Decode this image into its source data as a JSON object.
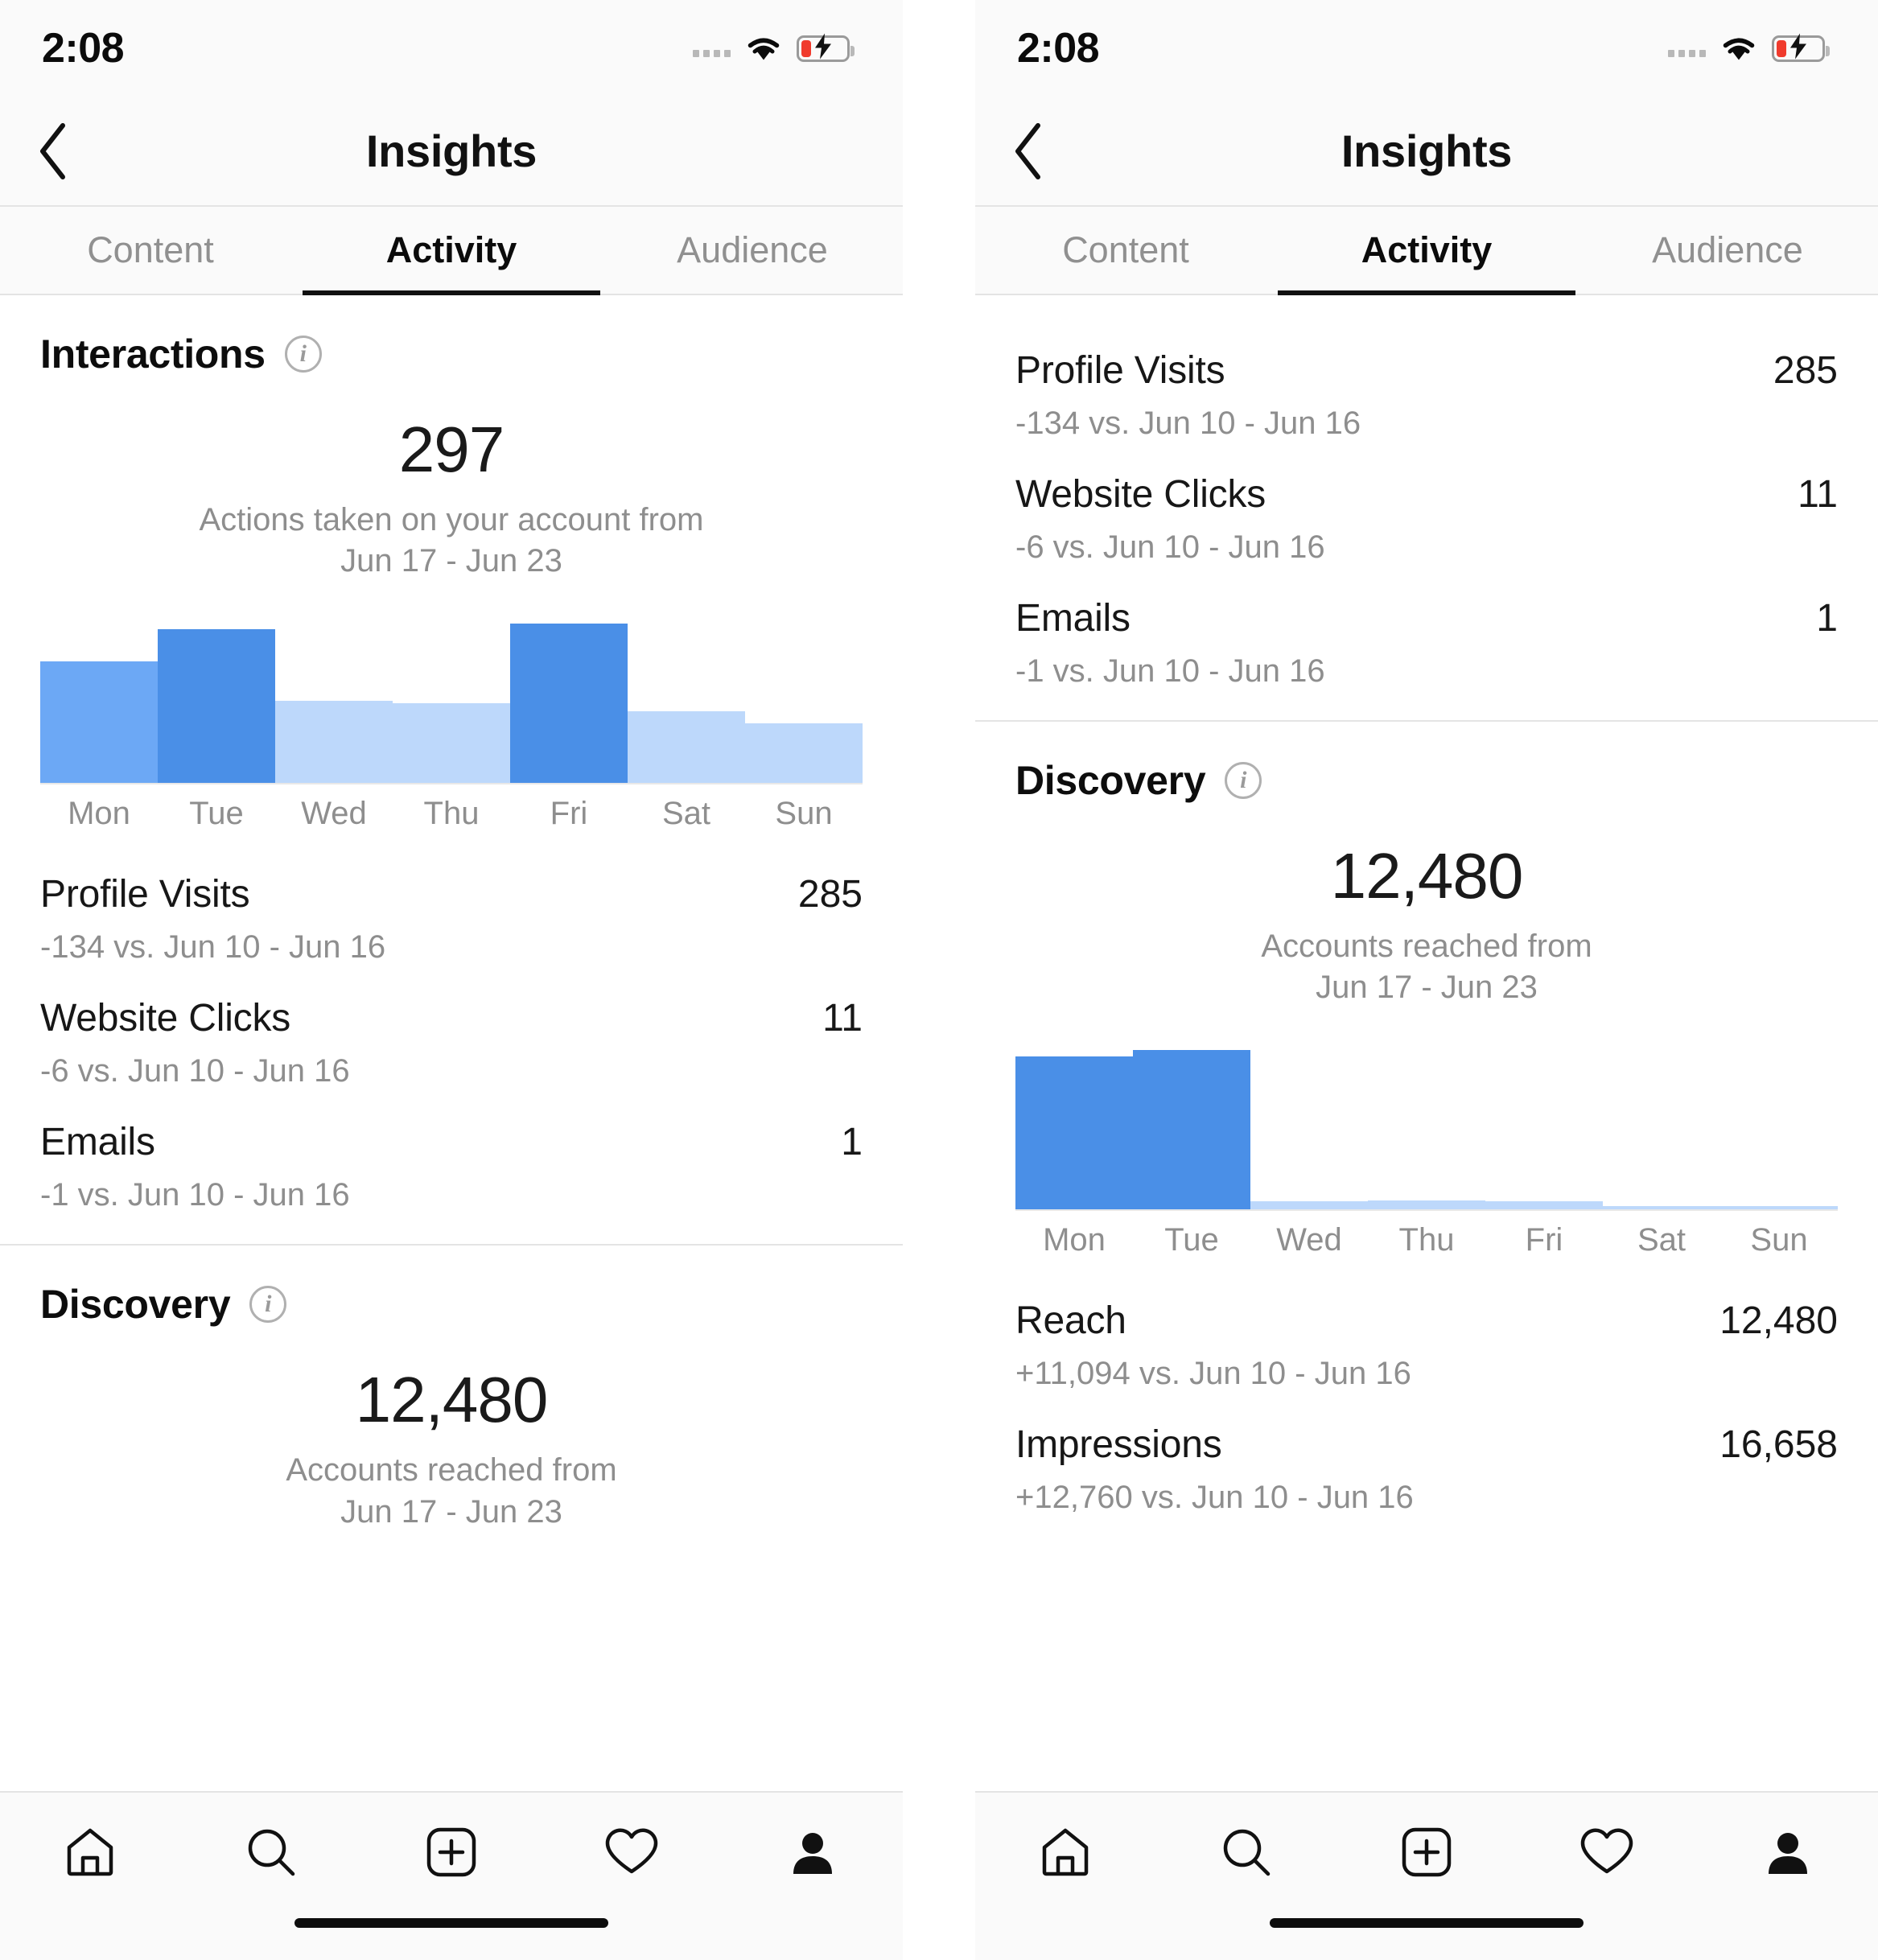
{
  "status_bar": {
    "time": "2:08",
    "signal_icon": "signal-dots-icon",
    "wifi_icon": "wifi-icon",
    "battery_icon": "battery-low-charging-icon"
  },
  "header": {
    "back_icon": "chevron-left-icon",
    "title": "Insights"
  },
  "tabs": [
    {
      "label": "Content",
      "active": false
    },
    {
      "label": "Activity",
      "active": true
    },
    {
      "label": "Audience",
      "active": false
    }
  ],
  "left_panel": {
    "interactions": {
      "title": "Interactions",
      "info_icon": "info-icon",
      "total": "297",
      "subtitle_line1": "Actions taken on your account from",
      "subtitle_line2": "Jun 17 - Jun 23"
    },
    "metrics": [
      {
        "name": "Profile Visits",
        "value": "285",
        "comparison": "-134 vs. Jun 10 - Jun 16"
      },
      {
        "name": "Website Clicks",
        "value": "11",
        "comparison": "-6 vs. Jun 10 - Jun 16"
      },
      {
        "name": "Emails",
        "value": "1",
        "comparison": "-1 vs. Jun 10 - Jun 16"
      }
    ],
    "discovery": {
      "title": "Discovery",
      "info_icon": "info-icon",
      "total": "12,480",
      "subtitle_line1": "Accounts reached from",
      "subtitle_line2": "Jun 17 - Jun 23"
    }
  },
  "right_panel": {
    "metrics": [
      {
        "name": "Profile Visits",
        "value": "285",
        "comparison": "-134 vs. Jun 10 - Jun 16"
      },
      {
        "name": "Website Clicks",
        "value": "11",
        "comparison": "-6 vs. Jun 10 - Jun 16"
      },
      {
        "name": "Emails",
        "value": "1",
        "comparison": "-1 vs. Jun 10 - Jun 16"
      }
    ],
    "discovery": {
      "title": "Discovery",
      "info_icon": "info-icon",
      "total": "12,480",
      "subtitle_line1": "Accounts reached from",
      "subtitle_line2": "Jun 17 - Jun 23"
    },
    "discovery_metrics": [
      {
        "name": "Reach",
        "value": "12,480",
        "comparison": "+11,094 vs. Jun 10 - Jun 16"
      },
      {
        "name": "Impressions",
        "value": "16,658",
        "comparison": "+12,760 vs. Jun 10 - Jun 16"
      }
    ]
  },
  "tab_bar": [
    {
      "icon": "home-icon",
      "label": "Home"
    },
    {
      "icon": "search-icon",
      "label": "Search"
    },
    {
      "icon": "add-post-icon",
      "label": "New Post"
    },
    {
      "icon": "heart-icon",
      "label": "Activity"
    },
    {
      "icon": "profile-icon",
      "label": "Profile"
    }
  ],
  "colors": {
    "bar_dark": "#4a8fe7",
    "bar_medium": "#6ca8f5",
    "bar_light": "#bdd8fb",
    "accent_text": "#0d0d0d",
    "muted_text": "#8e8e8e",
    "battery_low": "#f03b2d"
  },
  "chart_data": [
    {
      "type": "bar",
      "id": "interactions-weekly-chart",
      "title": "Interactions",
      "categories": [
        "Mon",
        "Tue",
        "Wed",
        "Thu",
        "Fri",
        "Sat",
        "Sun"
      ],
      "values": [
        49,
        62,
        33,
        32,
        64,
        29,
        24
      ],
      "colors": [
        "#6ca8f5",
        "#4a8fe7",
        "#bdd8fb",
        "#bdd8fb",
        "#4a8fe7",
        "#bdd8fb",
        "#bdd8fb"
      ],
      "xlabel": "",
      "ylabel": "",
      "ylim": [
        0,
        64
      ],
      "grid": false,
      "legend": false,
      "annotation": "297 Actions taken on your account from Jun 17 - Jun 23"
    },
    {
      "type": "bar",
      "id": "discovery-weekly-chart",
      "title": "Discovery",
      "categories": [
        "Mon",
        "Tue",
        "Wed",
        "Thu",
        "Fri",
        "Sat",
        "Sun"
      ],
      "values": [
        96,
        100,
        5,
        6,
        5,
        2,
        2
      ],
      "colors": [
        "#4a8fe7",
        "#4a8fe7",
        "#bdd8fb",
        "#bdd8fb",
        "#bdd8fb",
        "#bdd8fb",
        "#bdd8fb"
      ],
      "xlabel": "",
      "ylabel": "",
      "ylim": [
        0,
        100
      ],
      "grid": false,
      "legend": false,
      "annotation": "12,480 Accounts reached from Jun 17 - Jun 23"
    }
  ]
}
